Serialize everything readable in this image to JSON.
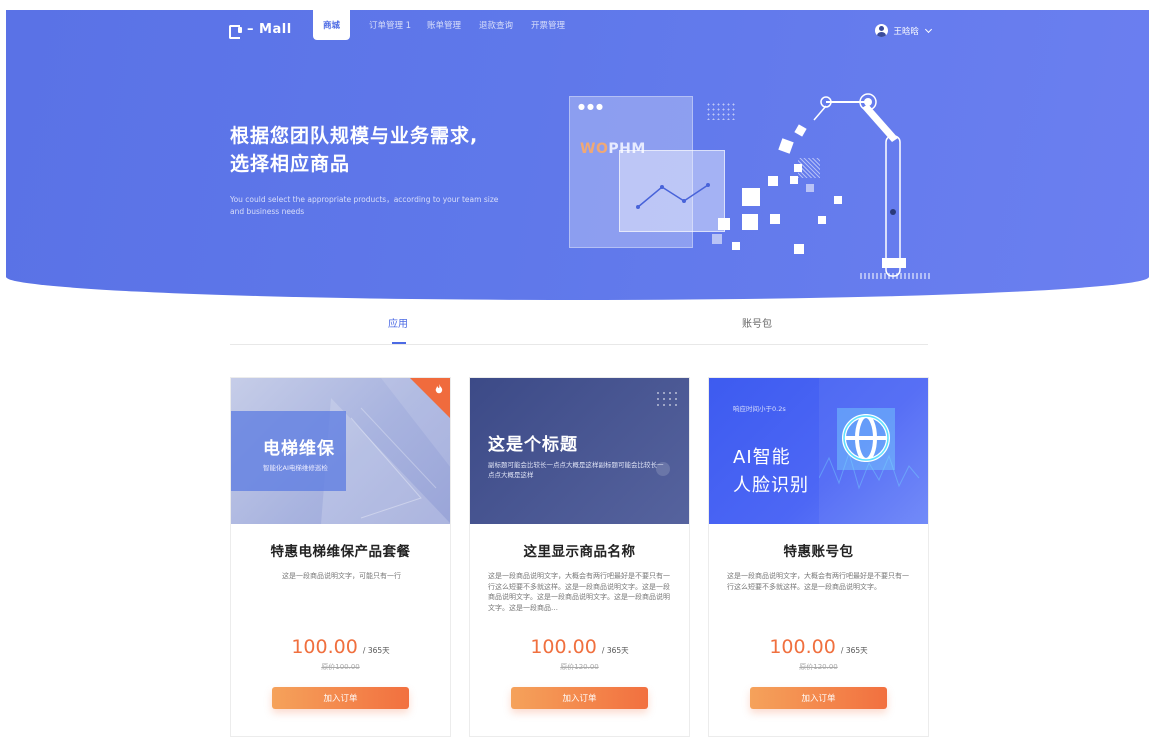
{
  "nav": {
    "logo": "– Mall",
    "items": [
      {
        "label": "商城",
        "active": true
      },
      {
        "label": "订单管理 1",
        "active": false
      },
      {
        "label": "账单管理",
        "active": false
      },
      {
        "label": "退款查询",
        "active": false
      },
      {
        "label": "开票管理",
        "active": false
      }
    ],
    "user_name": "王晗晗"
  },
  "hero": {
    "title_line1": "根据您团队规模与业务需求,",
    "title_line2": "选择相应商品",
    "subtitle": "You could select the appropriate products，according to your team size and business needs",
    "illustration_text_a": "WO",
    "illustration_text_b": "PHM"
  },
  "tabs": [
    {
      "label": "应用",
      "active": true
    },
    {
      "label": "账号包",
      "active": false
    }
  ],
  "cards": [
    {
      "image_title": "电梯维保",
      "image_subtitle": "智能化AI电梯维修巡检",
      "title": "特惠电梯维保产品套餐",
      "desc": "这是一段商品说明文字，可能只有一行",
      "price": "100.00",
      "unit": "/ 365天",
      "original": "原价100.00",
      "button": "加入订单",
      "hot": true
    },
    {
      "image_title": "这是个标题",
      "image_subtitle": "副标题可能会比较长一点点大概是这样副标题可能会比较长一点点大概是这样",
      "title": "这里显示商品名称",
      "desc": "这是一段商品说明文字，大概会有两行吧最好是不要只有一行这么短要不多就这样。这是一段商品说明文字。这是一段商品说明文字。这是一段商品说明文字。这是一段商品说明文字。这是一段商品…",
      "price": "100.00",
      "unit": "/ 365天",
      "original": "原价120.00",
      "button": "加入订单",
      "hot": false
    },
    {
      "image_top": "响应时间小于0.2s",
      "image_title_line1": "AI智能",
      "image_title_line2": "人脸识别",
      "title": "特惠账号包",
      "desc": "这是一段商品说明文字，大概会有两行吧最好是不要只有一行这么短要不多就这样。这是一段商品说明文字。",
      "price": "100.00",
      "unit": "/ 365天",
      "original": "原价120.00",
      "button": "加入订单",
      "hot": false
    }
  ],
  "colors": {
    "brand": "#5a72e6",
    "accent": "#f0703f",
    "tab_active": "#4c6ae4"
  }
}
